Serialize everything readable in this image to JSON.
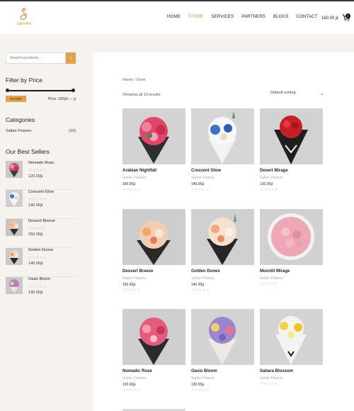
{
  "brand": {
    "name": "SAIFAN",
    "accent": "#e0a24a",
    "accent_text": "#c9913a"
  },
  "nav": {
    "items": [
      "HOME",
      "STORE",
      "SERVICES",
      "PARTNERS",
      "BLOGS",
      "CONTACT"
    ],
    "active": "STORE",
    "cart_total": "160.00.ﻺ",
    "cart_count": "1"
  },
  "sidebar": {
    "search_placeholder": "Search products...",
    "search_button_icon": "chevron-right-icon",
    "filter_title": "Filter by Price",
    "filter_button": "FILTER",
    "price_range": "Price: 160ﻺ — 0ﻺ",
    "categories_title": "Categories",
    "categories": [
      {
        "name": "Saifan Flowers",
        "count": "(10)"
      }
    ],
    "best_title": "Our Best Sellers",
    "best_sellers": [
      {
        "name": "Nomadic Rose",
        "stars": "☆☆☆☆☆",
        "price": "120.00ﻺ"
      },
      {
        "name": "Crescent Glow",
        "stars": "☆☆☆☆☆",
        "price": "140.00ﻺ"
      },
      {
        "name": "Dessert Breeze",
        "stars": "☆☆☆☆☆",
        "price": "150.00ﻺ"
      },
      {
        "name": "Golden Dunes",
        "stars": "☆☆☆☆☆",
        "price": "140.00ﻺ"
      },
      {
        "name": "Oasis Bloom",
        "stars": "☆☆☆☆☆",
        "price": "130.00ﻺ"
      }
    ]
  },
  "main": {
    "breadcrumb": "Home / Store",
    "result_count": "Showing all 10 results",
    "sorting": "Default sorting",
    "products": [
      {
        "name": "Arabian Nightfall",
        "store": "Saifan Flowers",
        "price": "160.00ﻺ",
        "stars": "☆☆☆☆☆"
      },
      {
        "name": "Crescent Glow",
        "store": "Saifan Flowers",
        "price": "140.00ﻺ",
        "stars": "☆☆☆☆☆"
      },
      {
        "name": "Desert Mirage",
        "store": "Saifan Flowers",
        "price": "130.00ﻺ",
        "stars": "☆☆☆☆☆"
      },
      {
        "name": "Dessert Breeze",
        "store": "Saifan Flowers",
        "price": "150.00ﻺ",
        "stars": "☆☆☆☆☆"
      },
      {
        "name": "Golden Dunes",
        "store": "Saifan Flowers",
        "price": "140.00ﻺ",
        "stars": "☆☆☆☆☆"
      },
      {
        "name": "Moonlit Mirage",
        "store": "Saifan Flowers",
        "price": "",
        "stars": "☆☆☆☆☆"
      },
      {
        "name": "Nomadic Rose",
        "store": "Saifan Flowers",
        "price": "120.00ﻺ",
        "stars": "☆☆☆☆☆"
      },
      {
        "name": "Oasis Bloom",
        "store": "Saifan Flowers",
        "price": "130.00ﻺ",
        "stars": "☆☆☆☆☆"
      },
      {
        "name": "Sahara Blossom",
        "store": "Saifan Flowers",
        "price": "",
        "stars": "☆☆☆☆☆"
      }
    ]
  }
}
